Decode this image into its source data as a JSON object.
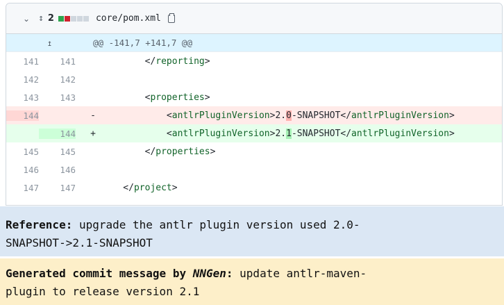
{
  "file": {
    "chevron_icon": "chevron-down-icon",
    "expand_icon": "unfold-icon",
    "changes_count": "2",
    "change_blocks": [
      "#2da44e",
      "#cf222e",
      "#d0d7de",
      "#d0d7de",
      "#d0d7de"
    ],
    "path": "core/pom.xml",
    "copy_icon": "copy-icon"
  },
  "hunk": {
    "expand_up_icon": "expand-up-icon",
    "header": "@@ -141,7 +141,7 @@"
  },
  "lines": [
    {
      "old": "141",
      "new": "141",
      "sign": "",
      "type": "ctx",
      "pre": "        </",
      "tag": "reporting",
      "post": ">"
    },
    {
      "old": "142",
      "new": "142",
      "sign": "",
      "type": "ctx",
      "pre": "",
      "tag": "",
      "post": ""
    },
    {
      "old": "143",
      "new": "143",
      "sign": "",
      "type": "ctx",
      "pre": "        <",
      "tag": "properties",
      "post": ">"
    },
    {
      "old": "144",
      "new": "",
      "sign": "-",
      "type": "del",
      "pre": "            <",
      "tag": "antlrPluginVersion",
      "mid1": ">2.",
      "hl": "0",
      "mid2": "-SNAPSHOT</",
      "tag2": "antlrPluginVersion",
      "post": ">"
    },
    {
      "old": "",
      "new": "144",
      "sign": "+",
      "type": "add",
      "pre": "            <",
      "tag": "antlrPluginVersion",
      "mid1": ">2.",
      "hl": "1",
      "mid2": "-SNAPSHOT</",
      "tag2": "antlrPluginVersion",
      "post": ">"
    },
    {
      "old": "145",
      "new": "145",
      "sign": "",
      "type": "ctx",
      "pre": "        </",
      "tag": "properties",
      "post": ">"
    },
    {
      "old": "146",
      "new": "146",
      "sign": "",
      "type": "ctx",
      "pre": "",
      "tag": "",
      "post": ""
    },
    {
      "old": "147",
      "new": "147",
      "sign": "",
      "type": "ctx",
      "pre": "    </",
      "tag": "project",
      "post": ">"
    }
  ],
  "reference": {
    "label": "Reference:",
    "text": " upgrade the antlr plugin version used 2.0-",
    "text2": "SNAPSHOT->2.1-SNAPSHOT"
  },
  "generated": {
    "label": "Generated commit message by ",
    "model": "NNGen",
    "colon": ":",
    "text": " update antlr-maven-",
    "text2": "plugin to release version 2.1"
  },
  "colors": {
    "added": "#e6ffec",
    "deleted": "#ffebe9",
    "hunk": "#ddf4ff",
    "ref_bg": "#dbe7f4",
    "gen_bg": "#fdefc9"
  }
}
